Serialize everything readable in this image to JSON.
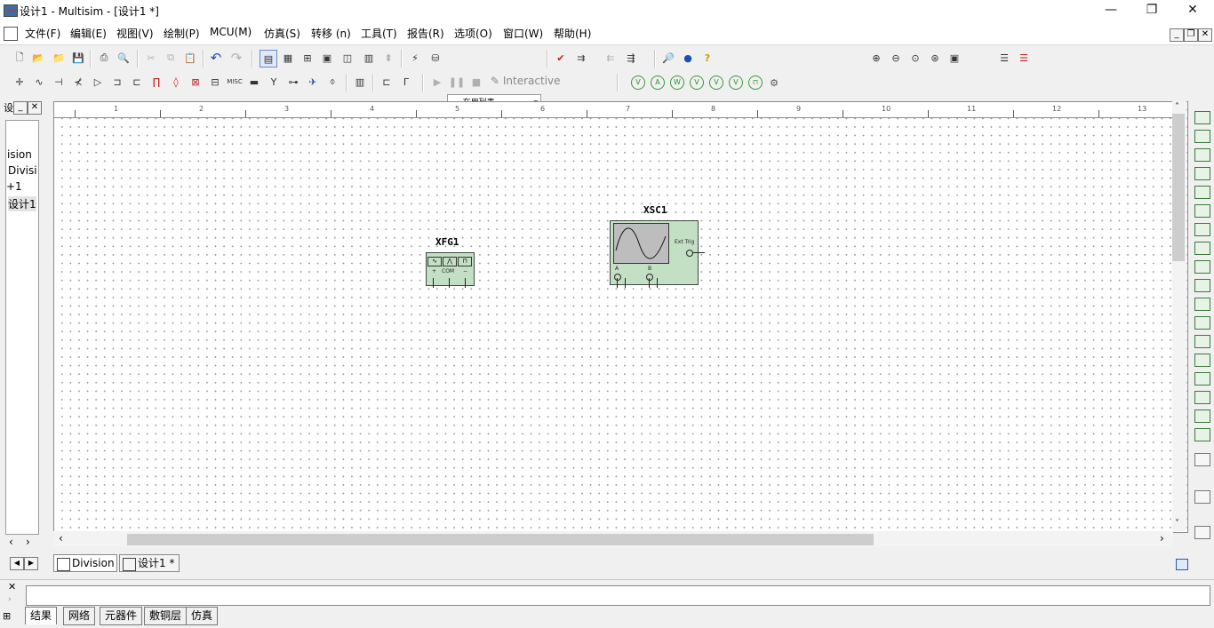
{
  "window": {
    "title": "设计1 - Multisim - [设计1 *]",
    "minimize": "—",
    "maximize": "❐",
    "close": "✕"
  },
  "menu": [
    "文件(F)",
    "编辑(E)",
    "视图(V)",
    "绘制(P)",
    "MCU(M)",
    "仿真(S)",
    "转移 (n)",
    "工具(T)",
    "报告(R)",
    "选项(O)",
    "窗口(W)",
    "帮助(H)"
  ],
  "mdi": {
    "minimize": "_",
    "restore": "❐",
    "close": "✕"
  },
  "toolbar": {
    "inuse_list": "--- 在用列表 ---",
    "interactive": "Interactive"
  },
  "left_panel": {
    "items": [
      "ision",
      "Divisi",
      "+1",
      "设计1"
    ]
  },
  "ruler": [
    "1",
    "2",
    "3",
    "4",
    "5",
    "6",
    "7",
    "8",
    "9",
    "10",
    "11",
    "12",
    "13"
  ],
  "instruments": {
    "xfg1": {
      "label": "XFG1",
      "com": "COM",
      "plus": "+",
      "minus": "−"
    },
    "xsc1": {
      "label": "XSC1",
      "ext_trig": "Ext Trig",
      "a": "A",
      "b": "B"
    }
  },
  "doc_tabs": [
    "Division",
    "设计1 *"
  ],
  "bottom_tabs": [
    "结果",
    "网络",
    "元器件",
    "敷铜层",
    "仿真"
  ],
  "colors": {
    "instrument_bg": "#c4e0c4",
    "canvas_dots": "#9c9c9c"
  }
}
